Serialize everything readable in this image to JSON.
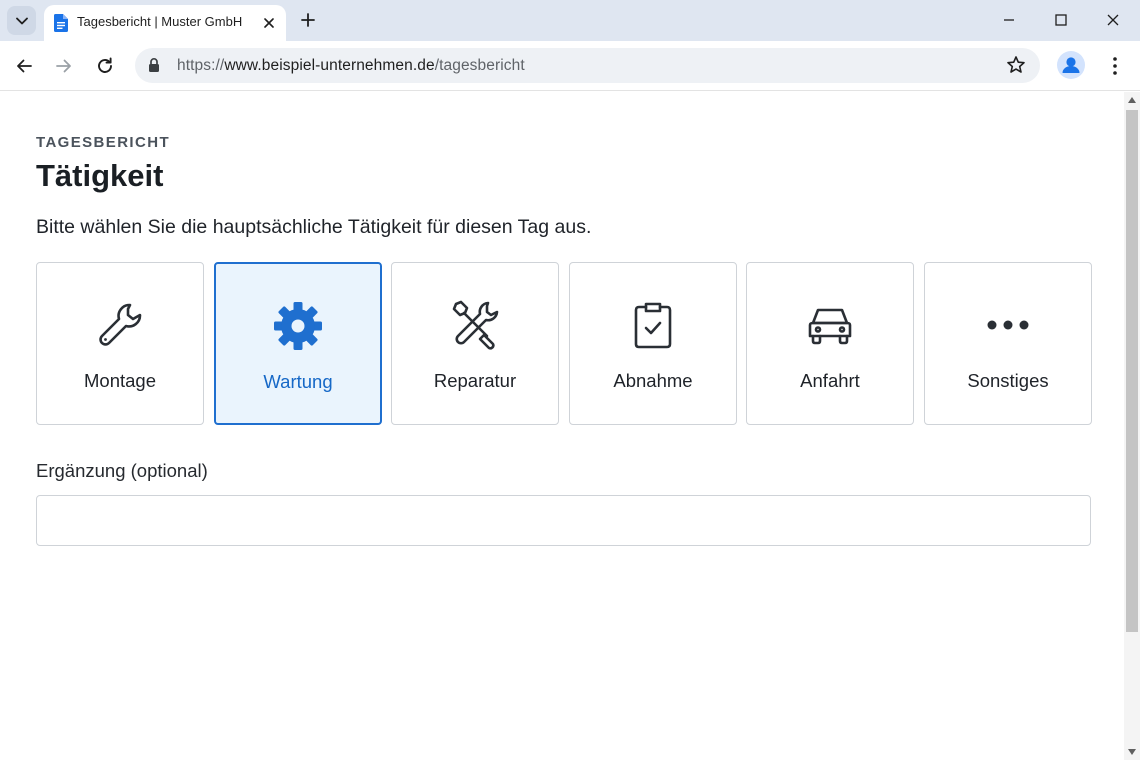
{
  "browser": {
    "tab": {
      "title": "Tagesbericht | Muster GmbH",
      "favicon": "document-icon"
    },
    "url": {
      "scheme": "https://",
      "host": "www.beispiel-unternehmen.de",
      "path": "/tagesbericht"
    },
    "colors": {
      "tabstrip": "#dfe6f1",
      "omnibox": "#eef1f5",
      "favicon": "#1a73e8"
    }
  },
  "page": {
    "eyebrow": "TAGESBERICHT",
    "title": "Tätigkeit",
    "instruction": "Bitte wählen Sie die hauptsächliche Tätigkeit für diesen Tag aus.",
    "options": [
      {
        "label": "Montage",
        "icon": "wrench-icon",
        "selected": false
      },
      {
        "label": "Wartung",
        "icon": "gear-icon",
        "selected": true
      },
      {
        "label": "Reparatur",
        "icon": "screwdriver-wrench-icon",
        "selected": false
      },
      {
        "label": "Abnahme",
        "icon": "clipboard-check-icon",
        "selected": false
      },
      {
        "label": "Anfahrt",
        "icon": "car-icon",
        "selected": false
      },
      {
        "label": "Sonstiges",
        "icon": "more-horizontal-icon",
        "selected": false
      }
    ],
    "supplement": {
      "label": "Ergänzung (optional)",
      "value": ""
    },
    "colors": {
      "accent": "#1f6fcf",
      "selected_background": "#eaf4fd",
      "border": "#cfd3d8"
    }
  }
}
